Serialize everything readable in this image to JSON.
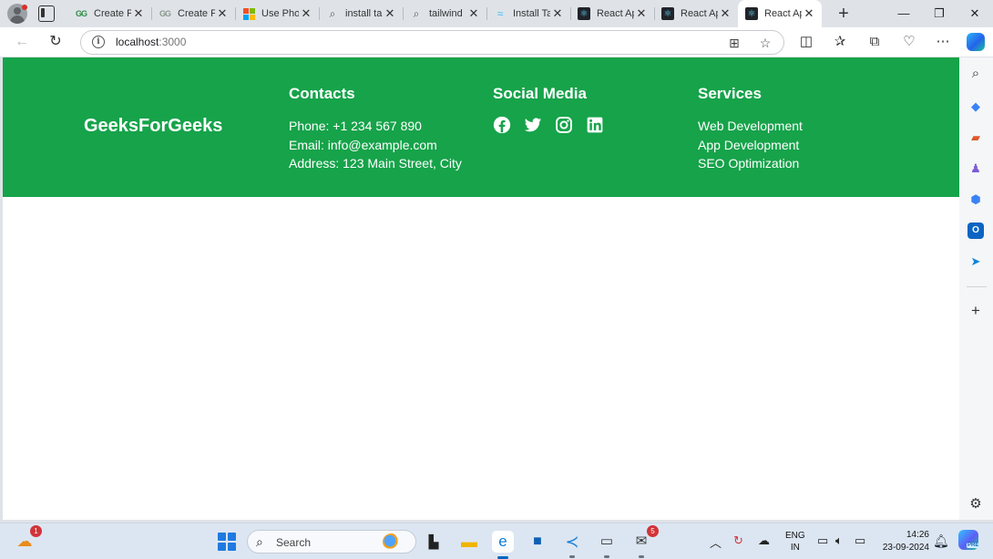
{
  "browser": {
    "tabs": [
      {
        "title": "Create Fo",
        "favicon": "gfg-icon"
      },
      {
        "title": "Create Fo",
        "favicon": "gfg-icon"
      },
      {
        "title": "Use Phon",
        "favicon": "microsoft-icon"
      },
      {
        "title": "install tai",
        "favicon": "search-icon"
      },
      {
        "title": "tailwind",
        "favicon": "search-icon"
      },
      {
        "title": "Install Ta",
        "favicon": "tailwind-icon"
      },
      {
        "title": "React Ap",
        "favicon": "react-icon"
      },
      {
        "title": "React Ap",
        "favicon": "react-icon"
      },
      {
        "title": "React Ap",
        "favicon": "react-icon",
        "active": true
      }
    ],
    "address": {
      "host": "localhost",
      "port": ":3000"
    }
  },
  "footer": {
    "brand": "GeeksForGeeks",
    "contacts": {
      "heading": "Contacts",
      "phone": "Phone: +1 234 567 890",
      "email": "Email: info@example.com",
      "address": "Address: 123 Main Street, City"
    },
    "social": {
      "heading": "Social Media",
      "icons": [
        "facebook-icon",
        "twitter-icon",
        "instagram-icon",
        "linkedin-icon"
      ]
    },
    "services": {
      "heading": "Services",
      "items": [
        "Web Development",
        "App Development",
        "SEO Optimization"
      ]
    },
    "colors": {
      "background": "#16a34a",
      "text": "#ffffff"
    }
  },
  "taskbar": {
    "search_placeholder": "Search",
    "weather_badge": "1",
    "mail_badge": "5",
    "language": "ENG",
    "region": "IN",
    "time": "14:26",
    "date": "23-09-2024",
    "copilot_tag": "PRE"
  }
}
